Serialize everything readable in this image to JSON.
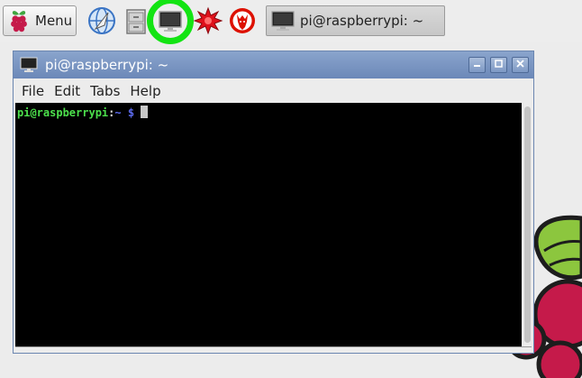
{
  "taskbar": {
    "menu_label": "Menu",
    "launchers": [
      {
        "name": "web-browser-icon"
      },
      {
        "name": "file-manager-icon"
      },
      {
        "name": "terminal-icon",
        "highlighted": true
      },
      {
        "name": "mathematica-icon"
      },
      {
        "name": "wolfram-icon"
      }
    ],
    "task_label": "pi@raspberrypi: ~"
  },
  "window": {
    "title": "pi@raspberrypi: ~",
    "controls": [
      "minimize",
      "maximize",
      "close"
    ],
    "menu": {
      "file": "File",
      "edit": "Edit",
      "tabs": "Tabs",
      "help": "Help"
    }
  },
  "terminal": {
    "user_host": "pi@raspberrypi",
    "separator": ":",
    "path": "~ $"
  },
  "colors": {
    "titlebar": "#7d98c4",
    "highlight_ring": "#13e413",
    "prompt_user": "#4ce04c",
    "prompt_path": "#5d6cf0"
  }
}
